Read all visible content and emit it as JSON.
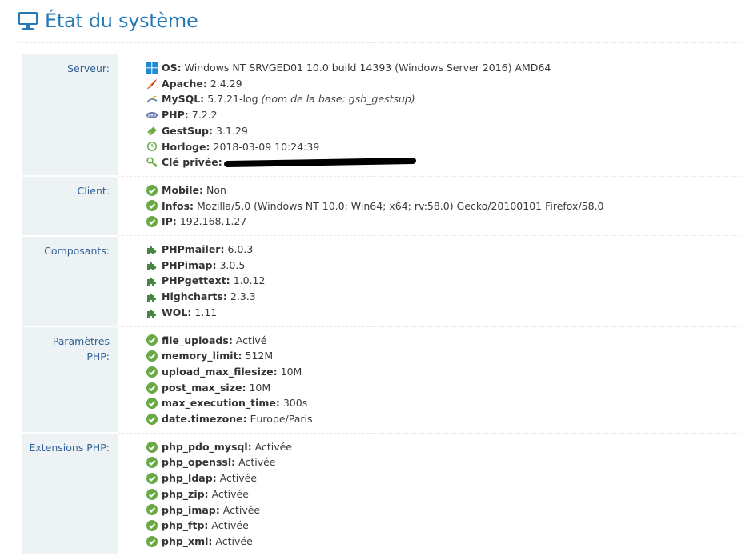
{
  "page": {
    "title": "État du système",
    "icon": "monitor-icon"
  },
  "sections": {
    "server": {
      "label": "Serveur:",
      "items": [
        {
          "key": "OS:",
          "value": "Windows NT SRVGED01 10.0 build 14393 (Windows Server 2016) AMD64",
          "icon": "windows-icon"
        },
        {
          "key": "Apache:",
          "value": "2.4.29",
          "icon": "apache-feather-icon"
        },
        {
          "key": "MySQL:",
          "value": "5.7.21-log",
          "note": "(nom de la base: gsb_gestsup)",
          "icon": "mysql-icon"
        },
        {
          "key": "PHP:",
          "value": "7.2.2",
          "icon": "php-icon"
        },
        {
          "key": "GestSup:",
          "value": "3.1.29",
          "icon": "ticket-icon"
        },
        {
          "key": "Horloge:",
          "value": "2018-03-09 10:24:39",
          "icon": "clock-icon"
        },
        {
          "key": "Clé privée:",
          "value": "",
          "icon": "key-icon"
        }
      ]
    },
    "client": {
      "label": "Client:",
      "items": [
        {
          "key": "Mobile:",
          "value": "Non",
          "icon": "check-circle-icon"
        },
        {
          "key": "Infos:",
          "value": "Mozilla/5.0 (Windows NT 10.0; Win64; x64; rv:58.0) Gecko/20100101 Firefox/58.0",
          "icon": "check-circle-icon"
        },
        {
          "key": "IP:",
          "value": "192.168.1.27",
          "icon": "check-circle-icon"
        }
      ]
    },
    "components": {
      "label": "Composants:",
      "items": [
        {
          "key": "PHPmailer:",
          "value": "6.0.3",
          "icon": "puzzle-icon"
        },
        {
          "key": "PHPimap:",
          "value": "3.0.5",
          "icon": "puzzle-icon"
        },
        {
          "key": "PHPgettext:",
          "value": "1.0.12",
          "icon": "puzzle-icon"
        },
        {
          "key": "Highcharts:",
          "value": "2.3.3",
          "icon": "puzzle-icon"
        },
        {
          "key": "WOL:",
          "value": "1.11",
          "icon": "puzzle-icon"
        }
      ]
    },
    "php_params": {
      "label_line1": "Paramètres",
      "label_line2": "PHP:",
      "items": [
        {
          "key": "file_uploads:",
          "value": "Activé",
          "icon": "check-circle-icon"
        },
        {
          "key": "memory_limit:",
          "value": "512M",
          "icon": "check-circle-icon"
        },
        {
          "key": "upload_max_filesize:",
          "value": "10M",
          "icon": "check-circle-icon"
        },
        {
          "key": "post_max_size:",
          "value": "10M",
          "icon": "check-circle-icon"
        },
        {
          "key": "max_execution_time:",
          "value": "300s",
          "icon": "check-circle-icon"
        },
        {
          "key": "date.timezone:",
          "value": "Europe/Paris",
          "icon": "check-circle-icon"
        }
      ]
    },
    "php_extensions": {
      "label": "Extensions PHP:",
      "items": [
        {
          "key": "php_pdo_mysql:",
          "value": "Activée",
          "icon": "check-circle-icon"
        },
        {
          "key": "php_openssl:",
          "value": "Activée",
          "icon": "check-circle-icon"
        },
        {
          "key": "php_ldap:",
          "value": "Activée",
          "icon": "check-circle-icon"
        },
        {
          "key": "php_zip:",
          "value": "Activée",
          "icon": "check-circle-icon"
        },
        {
          "key": "php_imap:",
          "value": "Activée",
          "icon": "check-circle-icon"
        },
        {
          "key": "php_ftp:",
          "value": "Activée",
          "icon": "check-circle-icon"
        },
        {
          "key": "php_xml:",
          "value": "Activée",
          "icon": "check-circle-icon"
        }
      ]
    }
  },
  "colors": {
    "title": "#2679b5",
    "label": "#336199",
    "label_bg": "#edf3f4",
    "ok_green": "#69aa46",
    "puzzle_green": "#478642"
  }
}
